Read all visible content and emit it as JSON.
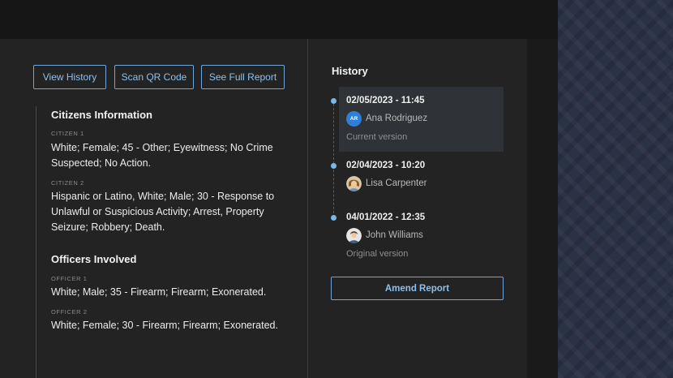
{
  "actions": {
    "view_history": "View History",
    "scan_qr": "Scan QR Code",
    "see_full_report": "See Full Report"
  },
  "citizens": {
    "title": "Citizens Information",
    "items": [
      {
        "label": "CITIZEN 1",
        "text": "White; Female; 45 - Other; Eyewitness; No Crime Suspected; No Action."
      },
      {
        "label": "CITIZEN 2",
        "text": "Hispanic or Latino, White; Male; 30 - Response to Unlawful or Suspicious Activity; Arrest, Property Seizure; Robbery; Death."
      }
    ]
  },
  "officers": {
    "title": "Officers Involved",
    "items": [
      {
        "label": "OFFICER 1",
        "text": "White; Male; 35 - Firearm; Firearm; Exonerated."
      },
      {
        "label": "OFFICER 2",
        "text": "White; Female; 30 - Firearm; Firearm; Exonerated."
      }
    ]
  },
  "history": {
    "title": "History",
    "entries": [
      {
        "date": "02/05/2023 - 11:45",
        "name": "Ana Rodriguez",
        "initials": "AR",
        "note": "Current version",
        "highlighted": true
      },
      {
        "date": "02/04/2023 - 10:20",
        "name": "Lisa Carpenter",
        "initials": "",
        "note": "",
        "highlighted": false
      },
      {
        "date": "04/01/2022 - 12:35",
        "name": "John Williams",
        "initials": "",
        "note": "Original version",
        "highlighted": false
      }
    ],
    "amend_label": "Amend Report"
  },
  "colors": {
    "accent": "#79b8ea",
    "panel": "#232323",
    "background_pattern": "#2a3245"
  }
}
